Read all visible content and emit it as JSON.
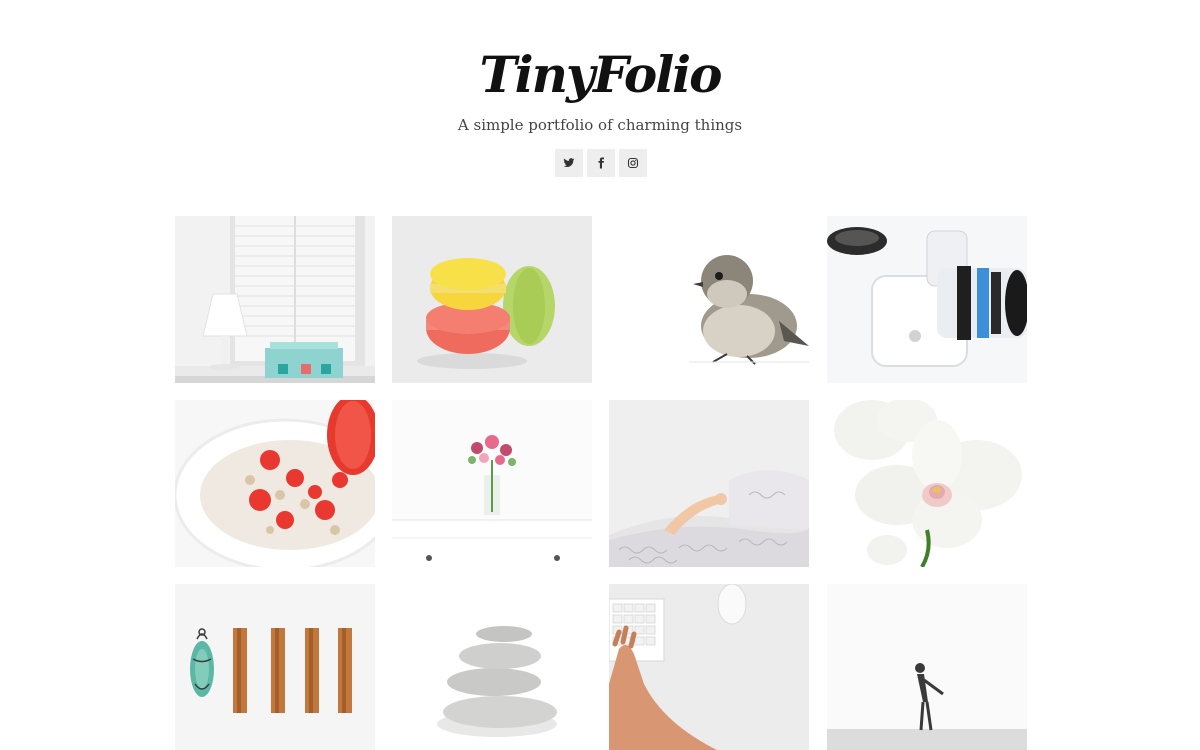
{
  "site": {
    "logo": "TinyFolio",
    "tagline": "A simple portfolio of charming things"
  },
  "social": [
    {
      "icon": "twitter-icon"
    },
    {
      "icon": "facebook-icon"
    },
    {
      "icon": "instagram-icon"
    }
  ],
  "gallery": [
    {
      "subject": "window-lamp"
    },
    {
      "subject": "macarons"
    },
    {
      "subject": "bird"
    },
    {
      "subject": "camera"
    },
    {
      "subject": "strawberry-cereal"
    },
    {
      "subject": "flower-vase"
    },
    {
      "subject": "bed-arm"
    },
    {
      "subject": "orchid"
    },
    {
      "subject": "cinnamon-sticks"
    },
    {
      "subject": "stacked-stones"
    },
    {
      "subject": "keyboard-hand"
    },
    {
      "subject": "person-silhouette"
    }
  ],
  "colors": {
    "text": "#111111",
    "tagline": "#444444",
    "social_bg": "#eeeeee",
    "social_icon": "#333333"
  }
}
